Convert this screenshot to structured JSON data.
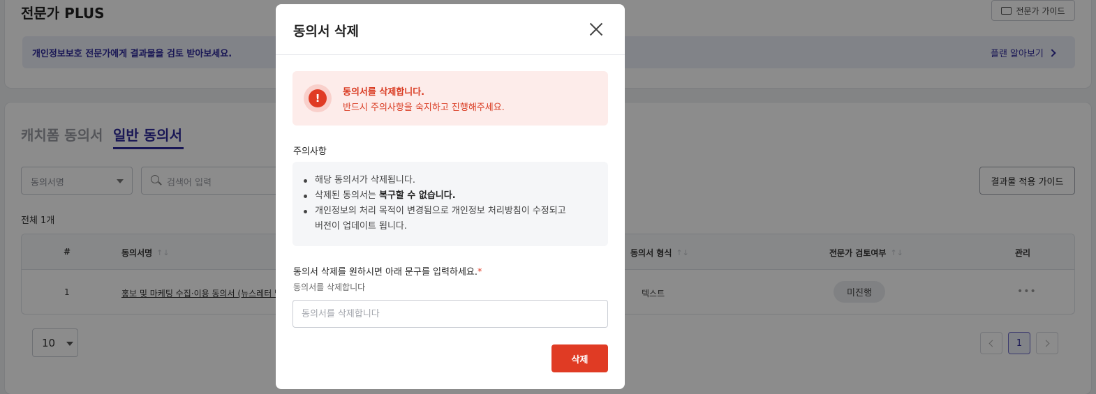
{
  "background": {
    "plus_title": "전문가 PLUS",
    "guide_button": "전문가 가이드",
    "banner_text": "개인정보보호 전문가에게 결과물을 검토 받아보세요.",
    "plan_link": "플랜 알아보기",
    "tabs": [
      "캐치폼 동의서",
      "일반 동의서"
    ],
    "filter_select": "동의서명",
    "search_placeholder": "검색어 입력",
    "apply_guide_button": "결과물 적용 가이드",
    "total_count": "전체 1개",
    "table": {
      "headers": [
        "#",
        "동의서명",
        "동의서 형식",
        "전문가 검토여부",
        "관리"
      ],
      "rows": [
        {
          "no": "1",
          "name": "홍보 및 마케팅 수집·이용 동의서 (뉴스레터 발",
          "format": "텍스트",
          "review_status": "미진행",
          "actions": "•••"
        }
      ]
    },
    "page_size": "10",
    "pagination": {
      "current": "1"
    }
  },
  "modal": {
    "title": "동의서 삭제",
    "alert": {
      "title": "동의서를 삭제합니다.",
      "description": "반드시 주의사항을 숙지하고 진행해주세요.",
      "icon_symbol": "!"
    },
    "notice_label": "주의사항",
    "notices": {
      "item1": "해당 동의서가 삭제됩니다.",
      "item2_prefix": "삭제된 동의서는 ",
      "item2_bold": "복구할 수 없습니다.",
      "item3_line1": "개인정보의 처리 목적이 변경됨으로 개인정보 처리방침이 수정되고",
      "item3_line2": "버전이 업데이트 됩니다."
    },
    "confirm_label": "동의서 삭제를 원하시면 아래 문구를 입력하세요.",
    "required_mark": "*",
    "confirm_phrase": "동의서를 삭제합니다",
    "input_placeholder": "동의서를 삭제합니다",
    "delete_button": "삭제"
  },
  "colors": {
    "accent": "#2f2a9c",
    "danger": "#e03b24",
    "alert_bg": "#fdecea"
  }
}
